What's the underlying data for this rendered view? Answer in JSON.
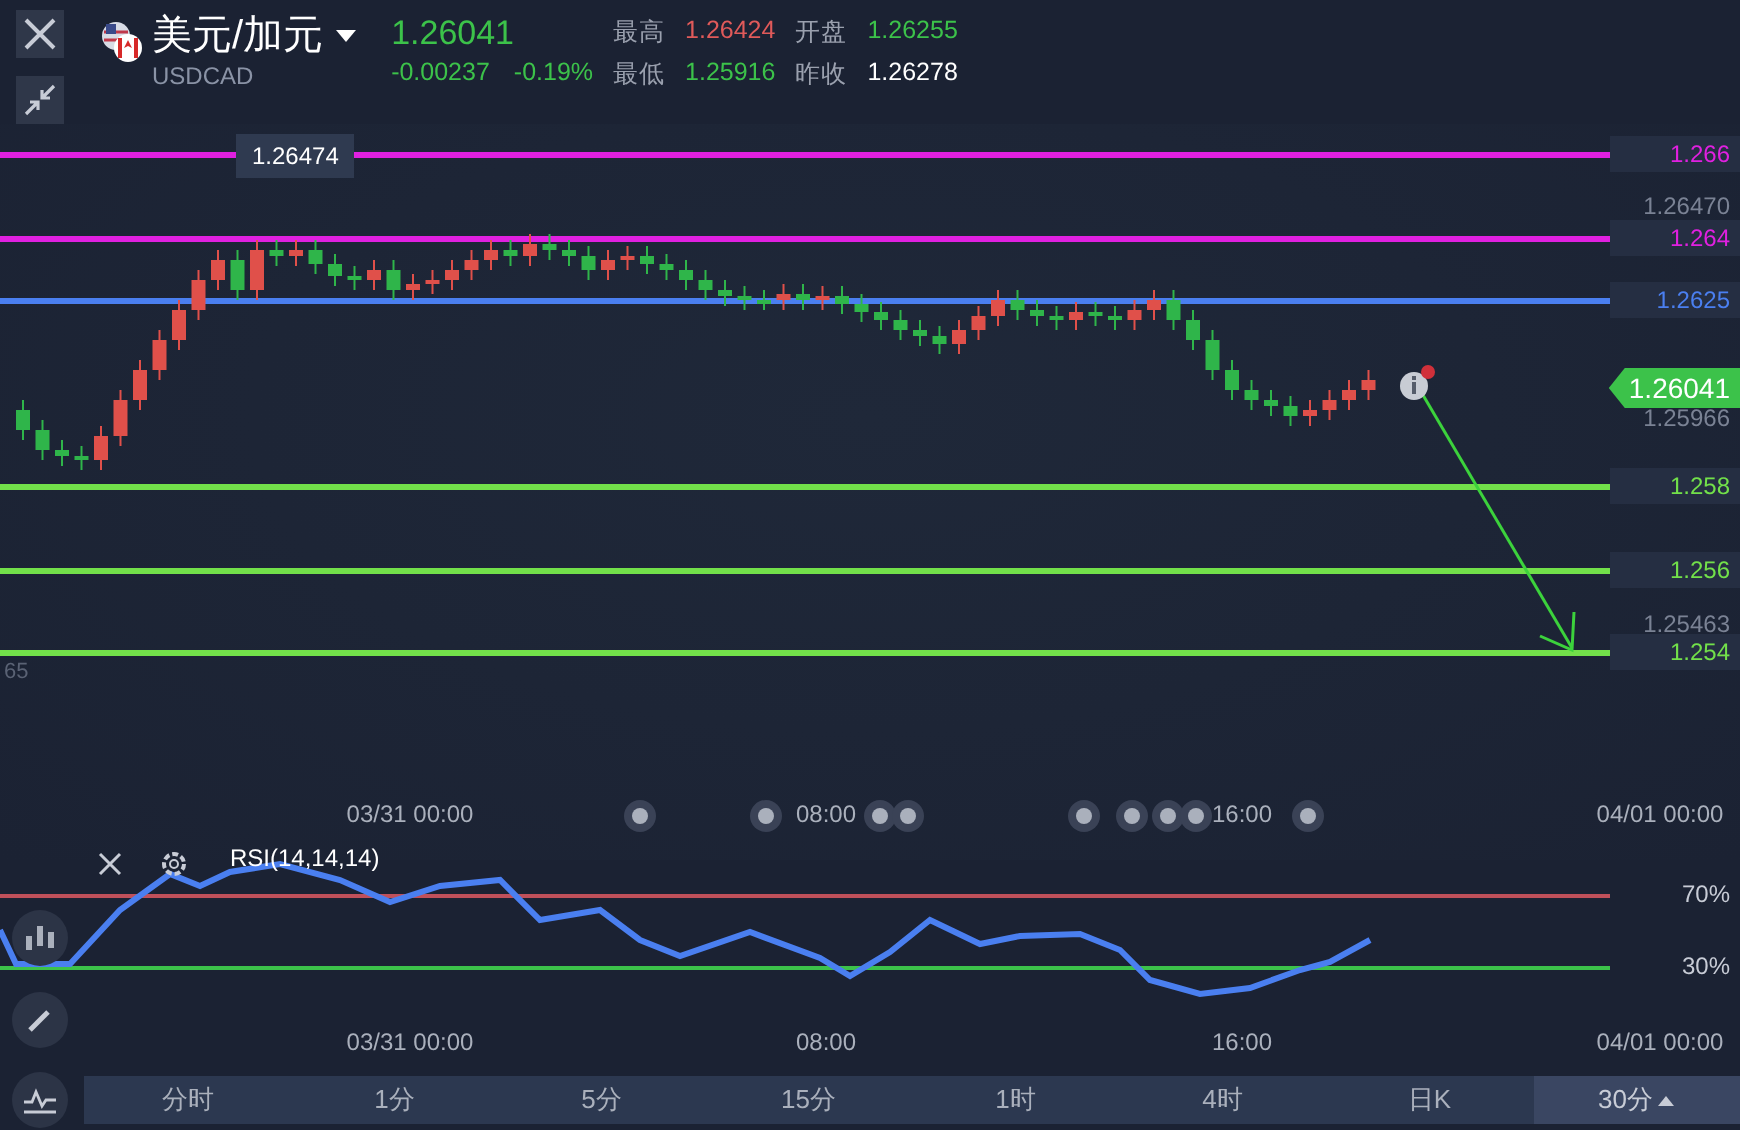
{
  "header": {
    "pair": "美元/加元",
    "symbol": "USDCAD",
    "price": "1.26041",
    "change": "-0.00237",
    "change_pct": "-0.19%",
    "stats": [
      {
        "label": "最高",
        "value": "1.26424",
        "color": "#e05a5a"
      },
      {
        "label": "开盘",
        "value": "1.26255",
        "color": "#3cc24a"
      },
      {
        "label": "最低",
        "value": "1.25916",
        "color": "#3cc24a"
      },
      {
        "label": "昨收",
        "value": "1.26278",
        "color": "#ffffff"
      }
    ]
  },
  "main_chart": {
    "high_marker": "1.26474",
    "left_edge_label": "65",
    "levels": [
      {
        "label": "1.266",
        "color": "#e020e0"
      },
      {
        "label": "1.264",
        "color": "#e020e0"
      },
      {
        "label": "1.2625",
        "color": "#4a7ff0"
      },
      {
        "label": "1.258",
        "color": "#72e04a"
      },
      {
        "label": "1.256",
        "color": "#72e04a"
      },
      {
        "label": "1.254",
        "color": "#72e04a"
      }
    ],
    "axis_labels": [
      "1.26470",
      "1.25966",
      "1.25463"
    ],
    "current_price": "1.26041",
    "time_labels": [
      "03/31 00:00",
      "08:00",
      "16:00",
      "04/01 00:00"
    ]
  },
  "rsi": {
    "title": "RSI(14,14,14)",
    "levels": [
      {
        "label": "70%",
        "color": "#c0505a"
      },
      {
        "label": "30%",
        "color": "#3cc24a"
      }
    ],
    "time_labels": [
      "03/31 00:00",
      "08:00",
      "16:00",
      "04/01 00:00"
    ]
  },
  "periods": [
    {
      "label": "分时",
      "selected": false
    },
    {
      "label": "1分",
      "selected": false
    },
    {
      "label": "5分",
      "selected": false
    },
    {
      "label": "15分",
      "selected": false
    },
    {
      "label": "1时",
      "selected": false
    },
    {
      "label": "4时",
      "selected": false
    },
    {
      "label": "日K",
      "selected": false
    },
    {
      "label": "30分",
      "selected": true
    }
  ]
}
